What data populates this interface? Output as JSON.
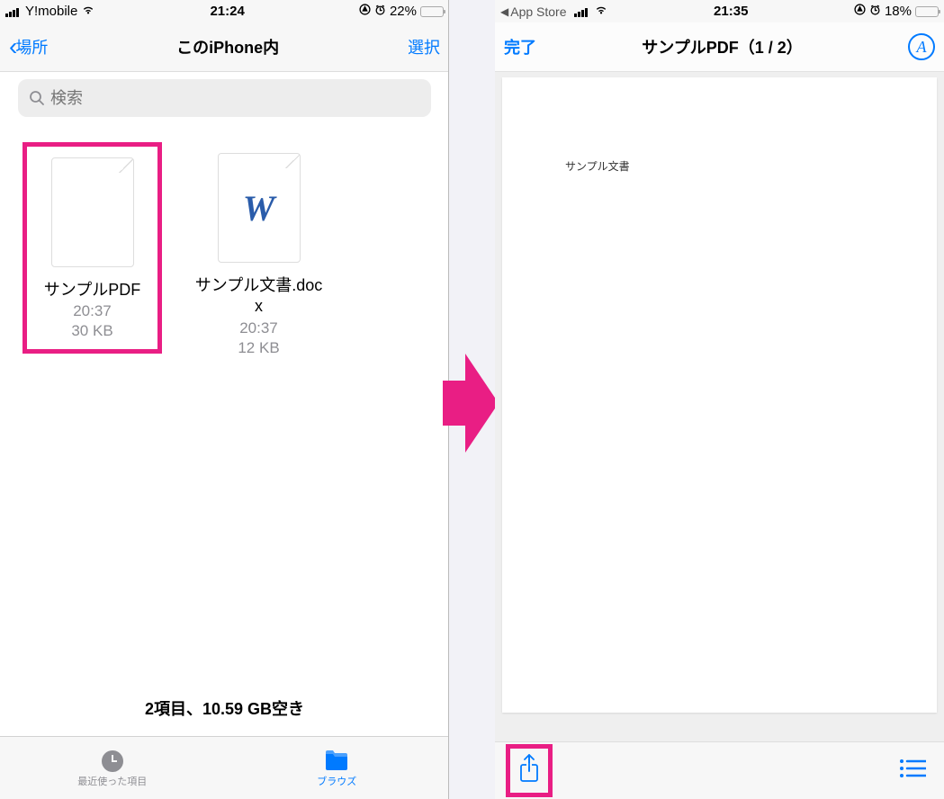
{
  "left": {
    "status": {
      "carrier": "Y!mobile",
      "time": "21:24",
      "battery_pct": "22%"
    },
    "nav": {
      "back": "場所",
      "title": "このiPhone内",
      "action": "選択"
    },
    "search": {
      "placeholder": "検索"
    },
    "files": [
      {
        "name": "サンプルPDF",
        "time": "20:37",
        "size": "30 KB"
      },
      {
        "name": "サンプル文書.docx",
        "time": "20:37",
        "size": "12 KB"
      }
    ],
    "footer": "2項目、10.59 GB空き",
    "tabs": {
      "recent": "最近使った項目",
      "browse": "ブラウズ"
    }
  },
  "right": {
    "status": {
      "back_to": "App Store",
      "time": "21:35",
      "battery_pct": "18%"
    },
    "nav": {
      "done": "完了",
      "title": "サンプルPDF（1 / 2）"
    },
    "pdf_content": "サンプル文書"
  }
}
